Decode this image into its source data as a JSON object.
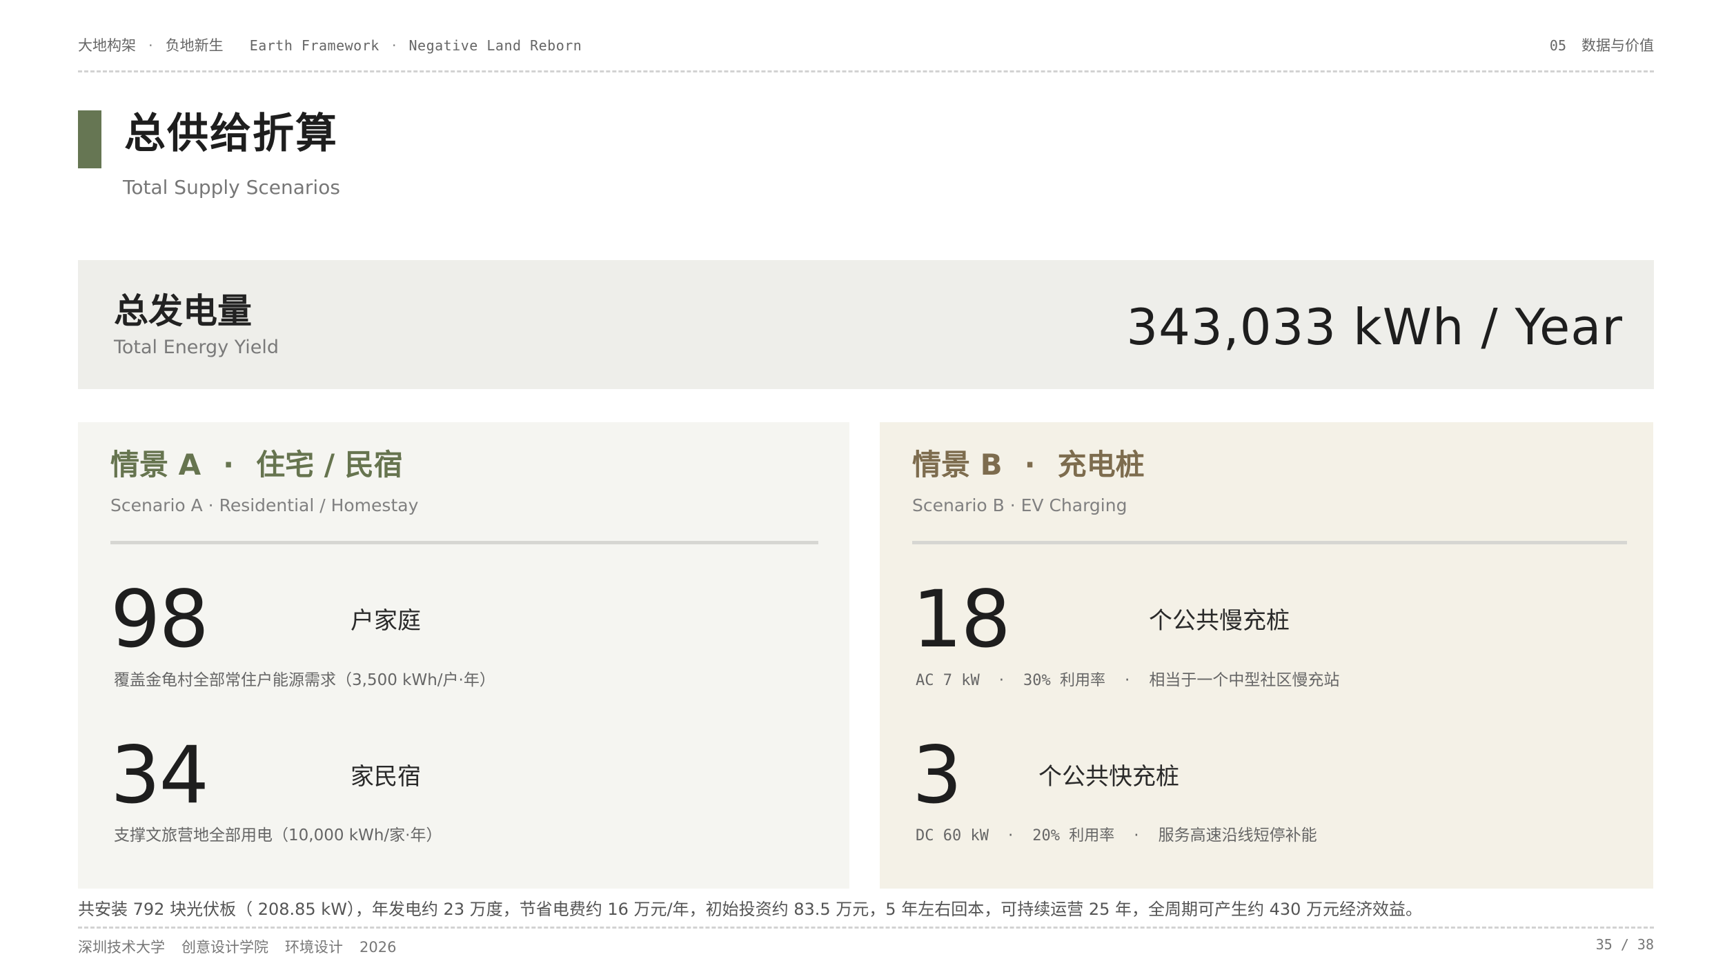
{
  "header": {
    "cn_part1": "大地构架",
    "separator": "·",
    "cn_part2": "负地新生",
    "en_part1": "Earth Framework",
    "en_part2": "Negative Land Reborn",
    "section_number": "05",
    "section_title": "数据与价值"
  },
  "title": {
    "cn": "总供给折算",
    "en": "Total Supply Scenarios"
  },
  "total_yield": {
    "label_cn": "总发电量",
    "label_en": "Total Energy Yield",
    "value": "343,033 kWh / Year"
  },
  "scenario_a": {
    "title_prefix": "情景 A",
    "title_dot": "·",
    "title_name": "住宅 / 民宿",
    "subtitle": "Scenario A · Residential / Homestay",
    "stat1": {
      "number": "98",
      "unit": "户家庭",
      "desc": "覆盖金龟村全部常住户能源需求（3,500 kWh/户·年）"
    },
    "stat2": {
      "number": "34",
      "unit": "家民宿",
      "desc": "支撑文旅营地全部用电（10,000 kWh/家·年）"
    }
  },
  "scenario_b": {
    "title_prefix": "情景 B",
    "title_dot": "·",
    "title_name": "充电桩",
    "subtitle": "Scenario B · EV Charging",
    "stat1": {
      "number": "18",
      "unit": "个公共慢充桩",
      "desc_parts": [
        "AC 7 kW",
        "·",
        "30% 利用率",
        "·",
        "相当于一个中型社区慢充站"
      ]
    },
    "stat2": {
      "number": "3",
      "unit": "个公共快充桩",
      "desc_parts": [
        "DC 60 kW",
        "·",
        "20% 利用率",
        "·",
        "服务高速沿线短停补能"
      ]
    }
  },
  "summary": "共安装 792 块光伏板（ 208.85 kW），年发电约 23 万度，节省电费约 16 万元/年，初始投资约 83.5 万元，5 年左右回本，可持续运营 25 年，全周期可产生约 430 万元经济效益。",
  "footer": {
    "university": "深圳技术大学",
    "college": "创意设计学院",
    "major": "环境设计",
    "year": "2026",
    "page": "35 / 38"
  },
  "colors": {
    "accent_green": "#667653",
    "accent_brown": "#7d6c4e",
    "band_bg": "#eeeeea",
    "card_a_bg": "#f5f5f1",
    "card_b_bg": "#f4f1e7"
  }
}
